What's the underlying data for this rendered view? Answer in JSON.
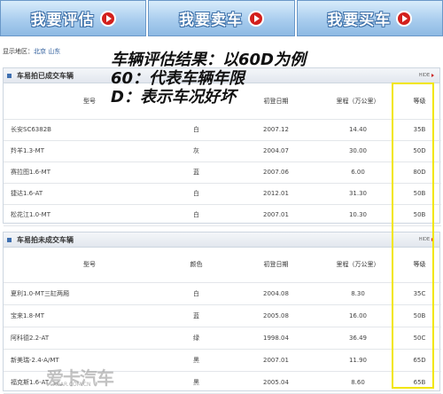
{
  "nav": {
    "buttons": [
      {
        "label": "我要评估"
      },
      {
        "label": "我要卖车"
      },
      {
        "label": "我要买车"
      }
    ]
  },
  "region": {
    "label": "显示地区：",
    "value": "北京 山东"
  },
  "annotation": {
    "line1": "车辆评估结果：以60D为例",
    "line2": "60：代表车辆年限",
    "line3": "D：表示车况好坏"
  },
  "section_sold": {
    "title": "车易拍已成交车辆",
    "hide": "HIDE",
    "headers": [
      "型号",
      "",
      "初登日期",
      "里程（万公里）",
      "等级"
    ],
    "rows": [
      [
        "长安SC6382B",
        "白",
        "2007.12",
        "14.40",
        "35B"
      ],
      [
        "羚羊1.3-MT",
        "灰",
        "2004.07",
        "30.00",
        "50D"
      ],
      [
        "赛拉图1.6-MT",
        "蓝",
        "2007.06",
        "6.00",
        "80D"
      ],
      [
        "捷达1.6-AT",
        "白",
        "2012.01",
        "31.30",
        "50B"
      ],
      [
        "松花江1.0-MT",
        "白",
        "2007.01",
        "10.30",
        "50B"
      ]
    ]
  },
  "section_unsold": {
    "title": "车易拍未成交车辆",
    "hide": "HIDE",
    "headers": [
      "型号",
      "颜色",
      "初登日期",
      "里程（万公里）",
      "等级"
    ],
    "rows": [
      [
        "夏利1.0-MT三缸两厢",
        "白",
        "2004.08",
        "8.30",
        "35C"
      ],
      [
        "宝来1.8-MT",
        "蓝",
        "2005.08",
        "16.00",
        "50B"
      ],
      [
        "阿科德2.2-AT",
        "绿",
        "1998.04",
        "36.49",
        "50C"
      ],
      [
        "新美瑞-2.4-A/MT",
        "黑",
        "2007.01",
        "11.90",
        "65D"
      ],
      [
        "福克斯1.6-AT",
        "黑",
        "2005.04",
        "8.60",
        "65B"
      ]
    ]
  },
  "watermark": {
    "text": "爱卡汽车",
    "url": "XCAR.COM.CN"
  }
}
